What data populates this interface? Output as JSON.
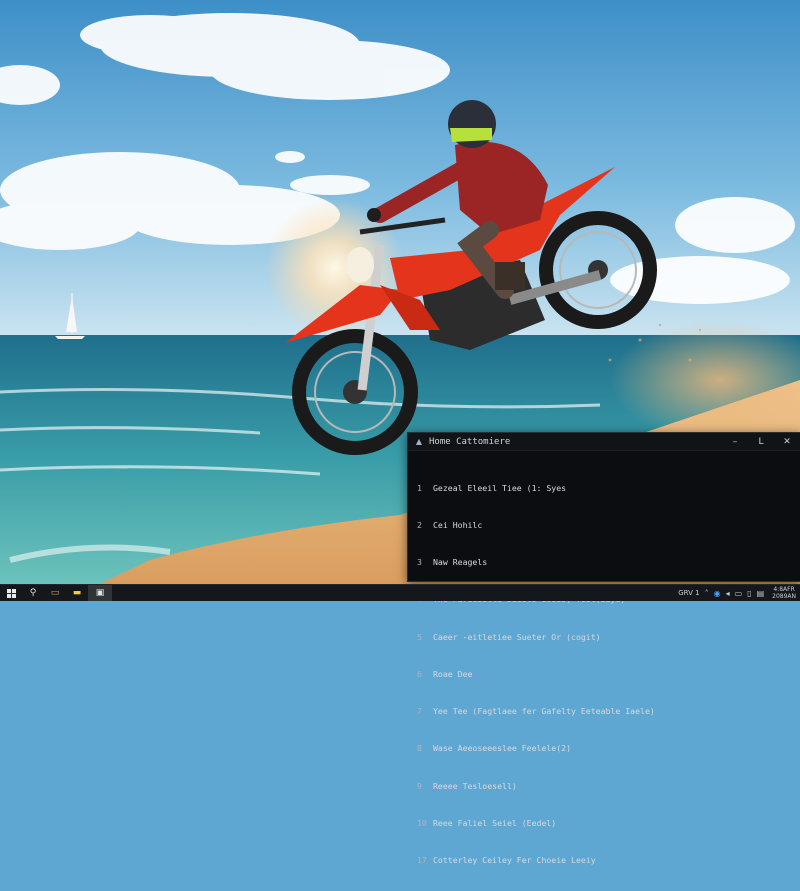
{
  "terminal": {
    "title": "Home Cattomiere",
    "controls": {
      "minimize": "–",
      "maximize": "L",
      "close": "✕"
    },
    "lines": [
      {
        "num": "1",
        "text": "Gezeal Eleeil Tiee (1: Syes"
      },
      {
        "num": "2",
        "text": "Cei Hohilc"
      },
      {
        "num": "3",
        "text": "Naw Reagels"
      },
      {
        "num": "4",
        "text": "The Fareesitle Jaeels Coeis( Teel(Eaye)"
      },
      {
        "num": "5",
        "text": "Caeer -eitletiee Sueter Or (cogit)"
      },
      {
        "num": "6",
        "text": "Roae Dee"
      },
      {
        "num": "7",
        "text": "Yee Tee (Fagtlaee fer Gafelty Eeteable Iaele)"
      },
      {
        "num": "8",
        "text": "Wase Aeeoseeeslee Feelele(2)"
      },
      {
        "num": "9",
        "text": "Reeee Tesloesell)"
      },
      {
        "num": "10",
        "text": "Reee Faliel Seiel (Eedel)"
      },
      {
        "num": "17",
        "text": "Cotterley Ceiley Fer Choeie Leeiy"
      }
    ]
  },
  "taskbar": {
    "start_icon": "windows-start-icon",
    "items": [
      {
        "icon": "search-icon",
        "glyph": "⚲"
      },
      {
        "icon": "browser-icon",
        "glyph": "▭"
      },
      {
        "icon": "folder-icon",
        "glyph": "▬"
      },
      {
        "icon": "terminal-icon",
        "glyph": "▣"
      }
    ],
    "tray_label": "GRV 1",
    "clock_time": "4:8AFR",
    "clock_date": "2089AN"
  },
  "colors": {
    "sky": "#5fa7d3",
    "sea": "#2f8f9e",
    "sand": "#e8b77c",
    "bike": "#e8321a",
    "terminal_bg": "#0b0d10",
    "taskbar_bg": "#14171b"
  }
}
